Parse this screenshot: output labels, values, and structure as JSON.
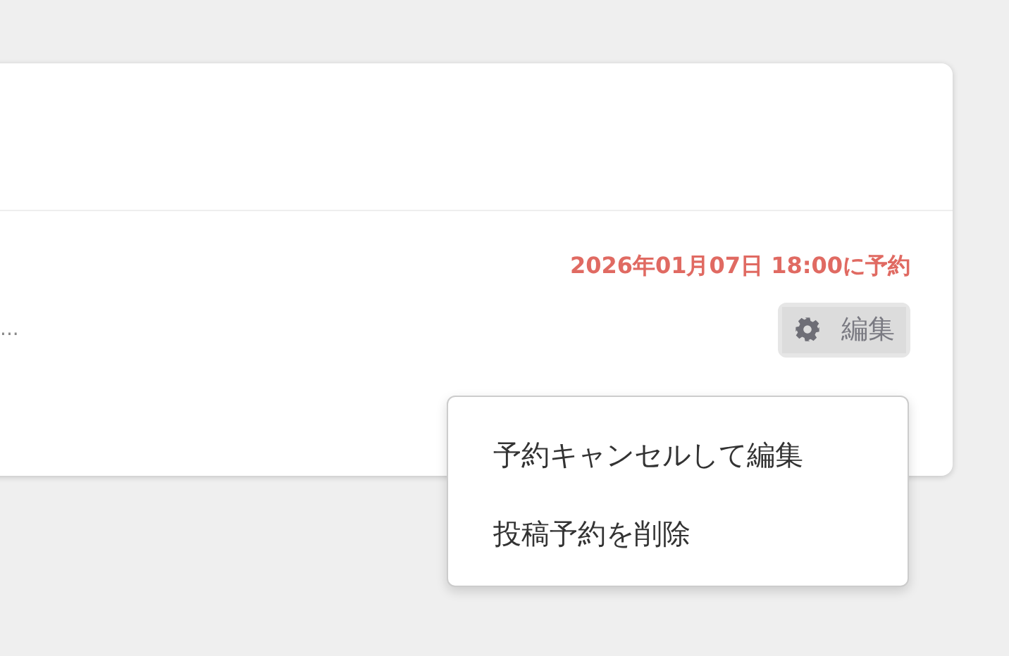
{
  "post": {
    "schedule": "2026年01月07日 18:00に予約",
    "excerpt": "...",
    "edit_button": {
      "label": "編集",
      "expanded": true
    }
  },
  "menu": {
    "items": [
      {
        "label": "予約キャンセルして編集"
      },
      {
        "label": "投稿予約を削除"
      }
    ]
  }
}
